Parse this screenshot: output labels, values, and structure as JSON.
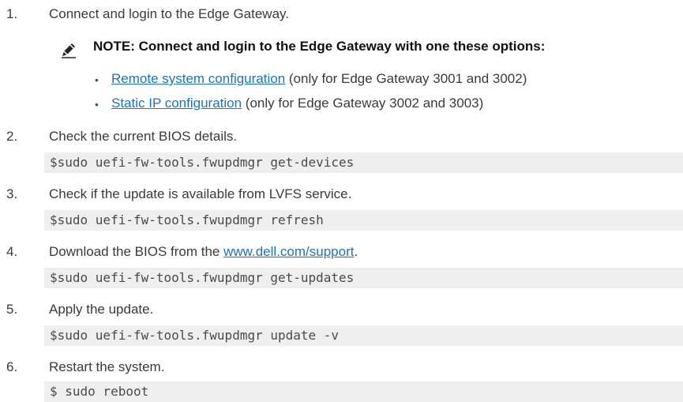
{
  "steps": [
    {
      "num": "1.",
      "text": "Connect and login to the Edge Gateway."
    },
    {
      "num": "2.",
      "text": "Check the current BIOS details.",
      "code": "$sudo uefi-fw-tools.fwupdmgr get-devices"
    },
    {
      "num": "3.",
      "text": "Check if the update is available from LVFS service.",
      "code": "$sudo uefi-fw-tools.fwupdmgr refresh"
    },
    {
      "num": "4.",
      "text_before": "Download the BIOS from the ",
      "link": "www.dell.com/support",
      "text_after": ".",
      "code": "$sudo uefi-fw-tools.fwupdmgr get-updates"
    },
    {
      "num": "5.",
      "text": "Apply the update.",
      "code": "$sudo uefi-fw-tools.fwupdmgr update -v"
    },
    {
      "num": "6.",
      "text": "Restart the system.",
      "code": "$ sudo reboot"
    }
  ],
  "note": {
    "icon": "pencil-icon",
    "title": "NOTE: Connect and login to the Edge Gateway with one these options:",
    "options": [
      {
        "bullet": "•",
        "link": "Remote system configuration",
        "text": " (only for Edge Gateway 3001 and 3002)"
      },
      {
        "bullet": "•",
        "link": "Static IP configuration",
        "text": " (only for Edge Gateway 3002 and 3003)"
      }
    ]
  },
  "colors": {
    "link": "#1a73c8",
    "code_bg": "#efefef",
    "text": "#3a3a3a"
  }
}
